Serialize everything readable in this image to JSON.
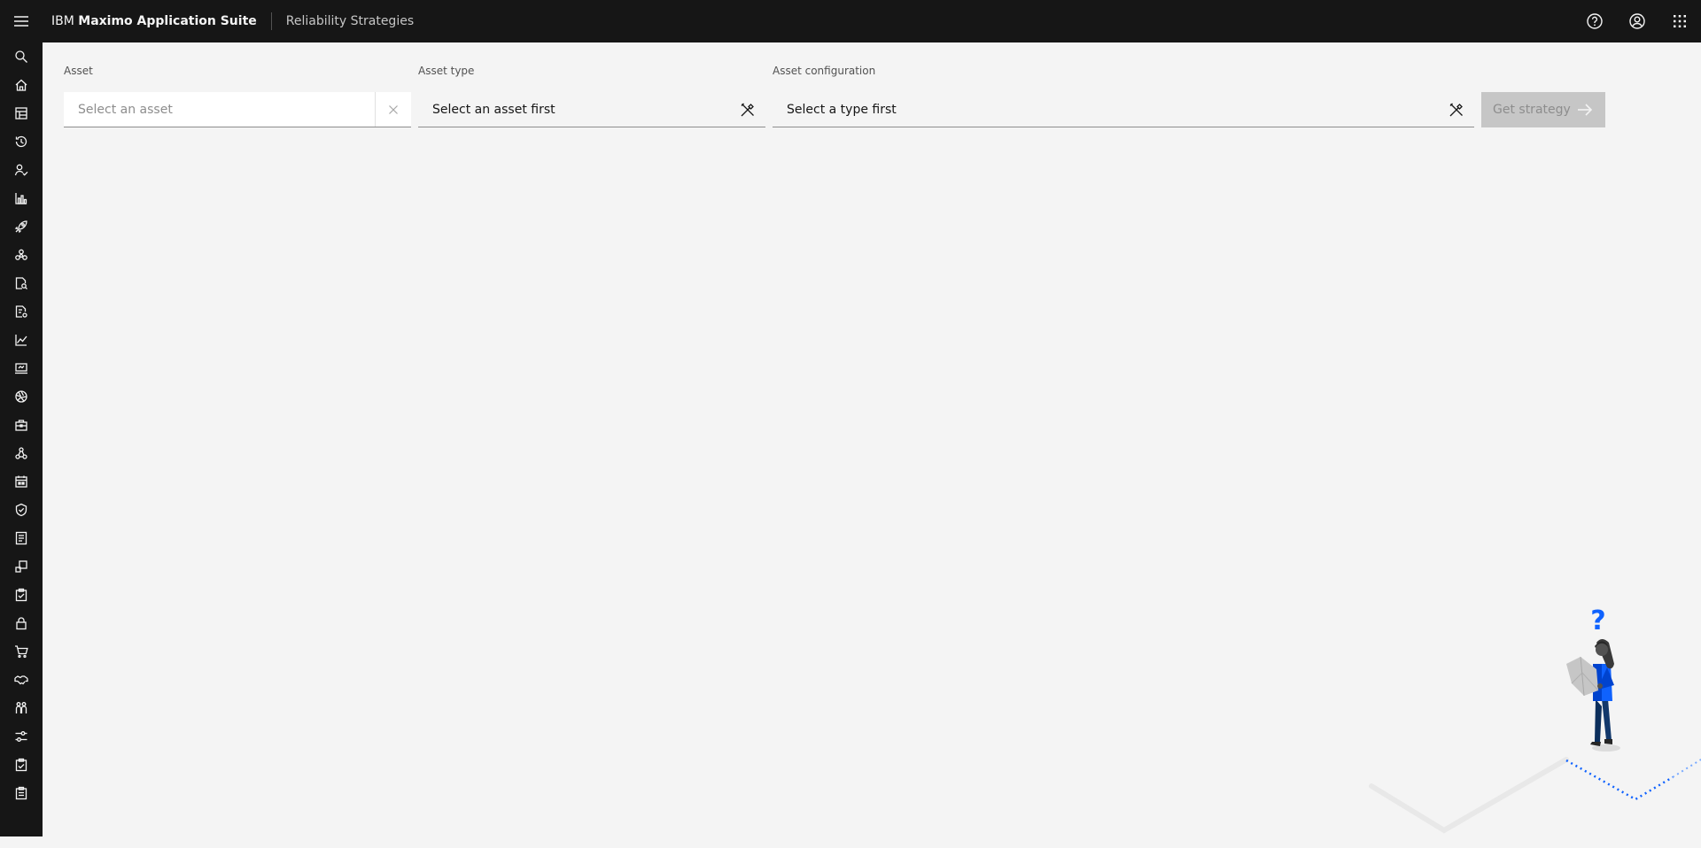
{
  "header": {
    "brand_prefix": "IBM",
    "brand_name": "Maximo Application Suite",
    "app_name": "Reliability Strategies",
    "actions": [
      "help-icon",
      "user-profile-icon",
      "app-switcher-icon"
    ]
  },
  "sidenav": {
    "items": [
      "search-icon",
      "home-icon",
      "dashboard-icon",
      "history-icon",
      "user-check-icon",
      "bar-chart-icon",
      "rocket-icon",
      "cluster-icon",
      "document-search-icon",
      "document-audit-icon",
      "line-chart-icon",
      "monitor-icon",
      "aperture-icon",
      "toolbox-icon",
      "network-icon",
      "calendar-icon",
      "shield-check-icon",
      "report-icon",
      "devices-icon",
      "clipboard-check-icon",
      "lock-icon",
      "cart-icon",
      "handshake-icon",
      "people-icon",
      "settings-adjust-icon",
      "task-complete-icon",
      "clipboard-icon"
    ]
  },
  "form": {
    "asset": {
      "label": "Asset",
      "placeholder": "Select an asset",
      "value": ""
    },
    "asset_type": {
      "label": "Asset type",
      "value": "Select an asset first"
    },
    "asset_config": {
      "label": "Asset configuration",
      "value": "Select a type first"
    },
    "get_strategy_label": "Get strategy",
    "get_strategy_enabled": false
  },
  "illustration": {
    "question_mark": "?"
  },
  "colors": {
    "header_bg": "#161616",
    "page_bg": "#f4f4f4",
    "accent": "#0f62fe",
    "disabled_button": "#c6c6c6"
  }
}
